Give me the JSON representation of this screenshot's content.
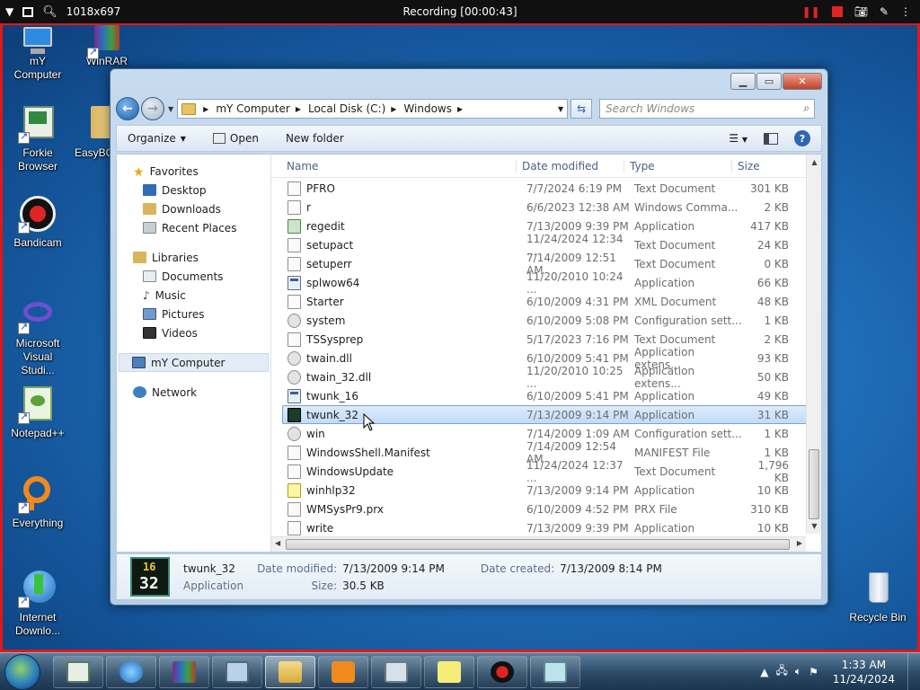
{
  "recording_bar": {
    "size_label": "1018x697",
    "title": "Recording [00:00:43]"
  },
  "desktop_icons": [
    {
      "label": "mY Computer"
    },
    {
      "label": "WinRAR"
    },
    {
      "label": "Forkie Browser"
    },
    {
      "label": "EasyBCD"
    },
    {
      "label": "Bandicam"
    },
    {
      "label": "Microsoft Visual Studi..."
    },
    {
      "label": "Notepad++"
    },
    {
      "label": "Everything"
    },
    {
      "label": "Internet Downlo..."
    },
    {
      "label": "Recycle Bin"
    }
  ],
  "window": {
    "address": {
      "crumbs": [
        "mY Computer",
        "Local Disk (C:)",
        "Windows"
      ]
    },
    "search_placeholder": "Search Windows",
    "toolbar": {
      "organize": "Organize",
      "open": "Open",
      "new_folder": "New folder"
    },
    "nav_pane": {
      "favorites": "Favorites",
      "desktop": "Desktop",
      "downloads": "Downloads",
      "recent": "Recent Places",
      "libraries": "Libraries",
      "documents": "Documents",
      "music": "Music",
      "pictures": "Pictures",
      "videos": "Videos",
      "computer": "mY Computer",
      "network": "Network"
    },
    "columns": {
      "name": "Name",
      "date": "Date modified",
      "type": "Type",
      "size": "Size"
    },
    "files": [
      {
        "name": "PFRO",
        "date": "7/7/2024 6:19 PM",
        "type": "Text Document",
        "size": "301 KB",
        "icon": "doc"
      },
      {
        "name": "r",
        "date": "6/6/2023 12:38 AM",
        "type": "Windows Comma...",
        "size": "2 KB",
        "icon": "doc"
      },
      {
        "name": "regedit",
        "date": "7/13/2009 9:39 PM",
        "type": "Application",
        "size": "417 KB",
        "icon": "reg"
      },
      {
        "name": "setupact",
        "date": "11/24/2024 12:34 ...",
        "type": "Text Document",
        "size": "24 KB",
        "icon": "doc"
      },
      {
        "name": "setuperr",
        "date": "7/14/2009 12:51 AM",
        "type": "Text Document",
        "size": "0 KB",
        "icon": "doc"
      },
      {
        "name": "splwow64",
        "date": "11/20/2010 10:24 ...",
        "type": "Application",
        "size": "66 KB",
        "icon": "app"
      },
      {
        "name": "Starter",
        "date": "6/10/2009 4:31 PM",
        "type": "XML Document",
        "size": "48 KB",
        "icon": "doc"
      },
      {
        "name": "system",
        "date": "6/10/2009 5:08 PM",
        "type": "Configuration sett...",
        "size": "1 KB",
        "icon": "cfg"
      },
      {
        "name": "TSSysprep",
        "date": "5/17/2023 7:16 PM",
        "type": "Text Document",
        "size": "2 KB",
        "icon": "doc"
      },
      {
        "name": "twain.dll",
        "date": "6/10/2009 5:41 PM",
        "type": "Application extens...",
        "size": "93 KB",
        "icon": "cfg"
      },
      {
        "name": "twain_32.dll",
        "date": "11/20/2010 10:25 ...",
        "type": "Application extens...",
        "size": "50 KB",
        "icon": "cfg"
      },
      {
        "name": "twunk_16",
        "date": "6/10/2009 5:41 PM",
        "type": "Application",
        "size": "49 KB",
        "icon": "app"
      },
      {
        "name": "twunk_32",
        "date": "7/13/2009 9:14 PM",
        "type": "Application",
        "size": "31 KB",
        "icon": "t32"
      },
      {
        "name": "win",
        "date": "7/14/2009 1:09 AM",
        "type": "Configuration sett...",
        "size": "1 KB",
        "icon": "cfg"
      },
      {
        "name": "WindowsShell.Manifest",
        "date": "7/14/2009 12:54 AM",
        "type": "MANIFEST File",
        "size": "1 KB",
        "icon": "doc"
      },
      {
        "name": "WindowsUpdate",
        "date": "11/24/2024 12:37 ...",
        "type": "Text Document",
        "size": "1,796 KB",
        "icon": "doc"
      },
      {
        "name": "winhlp32",
        "date": "7/13/2009 9:14 PM",
        "type": "Application",
        "size": "10 KB",
        "icon": "help"
      },
      {
        "name": "WMSysPr9.prx",
        "date": "6/10/2009 4:52 PM",
        "type": "PRX File",
        "size": "310 KB",
        "icon": "doc"
      },
      {
        "name": "write",
        "date": "7/13/2009 9:39 PM",
        "type": "Application",
        "size": "10 KB",
        "icon": "doc"
      }
    ],
    "details": {
      "name": "twunk_32",
      "kind": "Application",
      "modified_label": "Date modified:",
      "modified_value": "7/13/2009 9:14 PM",
      "created_label": "Date created:",
      "created_value": "7/13/2009 8:14 PM",
      "size_label": "Size:",
      "size_value": "30.5 KB",
      "icon_top": "16",
      "icon_bottom": "32"
    }
  },
  "taskbar": {
    "time": "1:33 AM",
    "date": "11/24/2024"
  },
  "colors": {
    "accent": "#2f67b0",
    "recording_border": "#e01818",
    "selection": "#c1dcfa"
  }
}
